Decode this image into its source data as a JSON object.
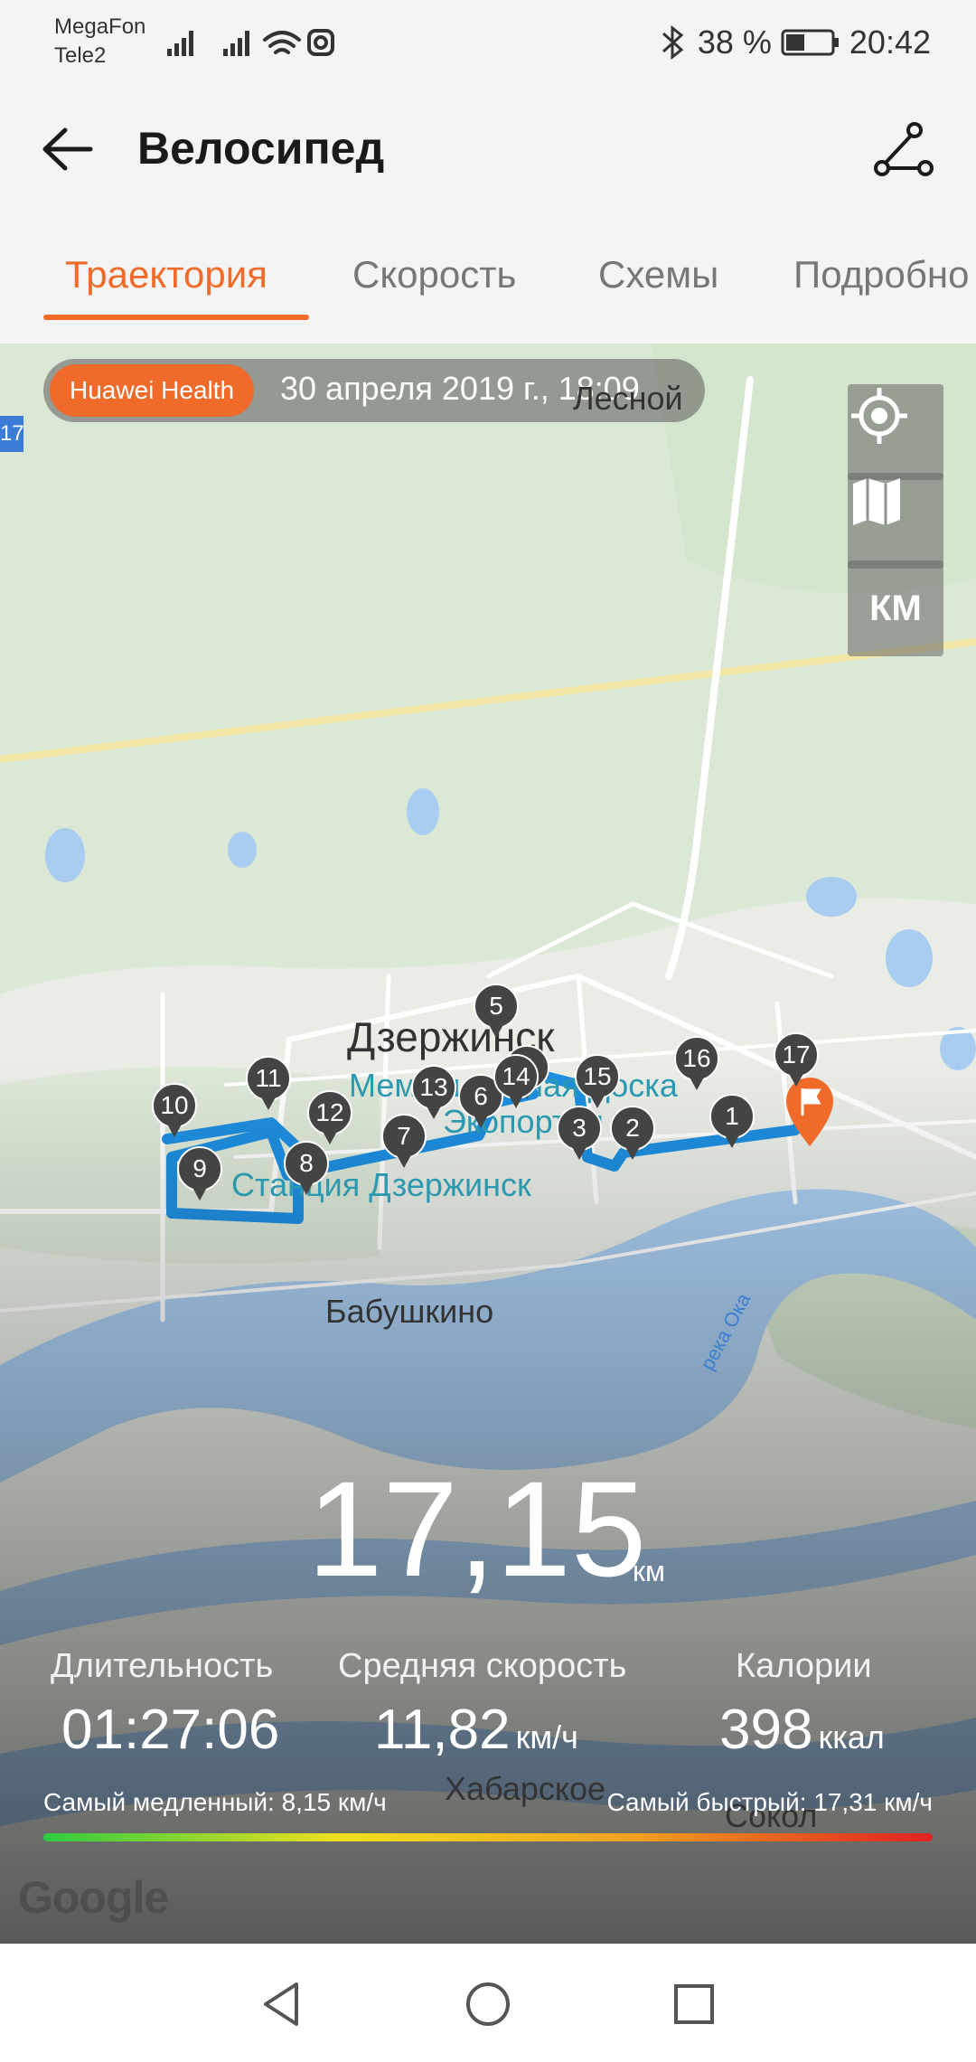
{
  "status_bar": {
    "carrier1": "MegaFon",
    "carrier2": "Tele2",
    "battery": "38 %",
    "time": "20:42"
  },
  "app_bar": {
    "title": "Велосипед"
  },
  "tabs": [
    {
      "label": "Траектория",
      "active": true
    },
    {
      "label": "Скорость"
    },
    {
      "label": "Схемы"
    },
    {
      "label": "Подробно"
    }
  ],
  "map": {
    "source_badge": "Huawei Health",
    "date": "30 апреля 2019 г., 18:09",
    "unit_button": "КМ",
    "road_tag": "17",
    "places": {
      "lesnoy": "Лесной",
      "city": "Дзержинск",
      "memorial": "Мемориальная Доска",
      "ecoportal": "Экопортал",
      "station": "Станция Дзержинск",
      "babushkino": "Бабушкино",
      "river": "река Ока",
      "khabarskoe": "Хабарское",
      "sokol": "Сокол"
    },
    "markers": [
      "1",
      "2",
      "3",
      "4",
      "5",
      "6",
      "7",
      "8",
      "9",
      "10",
      "11",
      "12",
      "13",
      "14",
      "15",
      "16",
      "17"
    ],
    "accent_color": "#f06a2a",
    "route_color": "#1e8fe0"
  },
  "summary": {
    "distance": "17,15",
    "distance_unit": "км",
    "duration_label": "Длительность",
    "duration": "01:27:06",
    "avg_speed_label": "Средняя скорость",
    "avg_speed": "11,82",
    "avg_speed_unit": "км/ч",
    "calories_label": "Калории",
    "calories": "398",
    "calories_unit": "ккал",
    "slowest": "Самый медленный: 8,15 км/ч",
    "fastest": "Самый быстрый: 17,31 км/ч"
  },
  "map_attribution": "Google"
}
